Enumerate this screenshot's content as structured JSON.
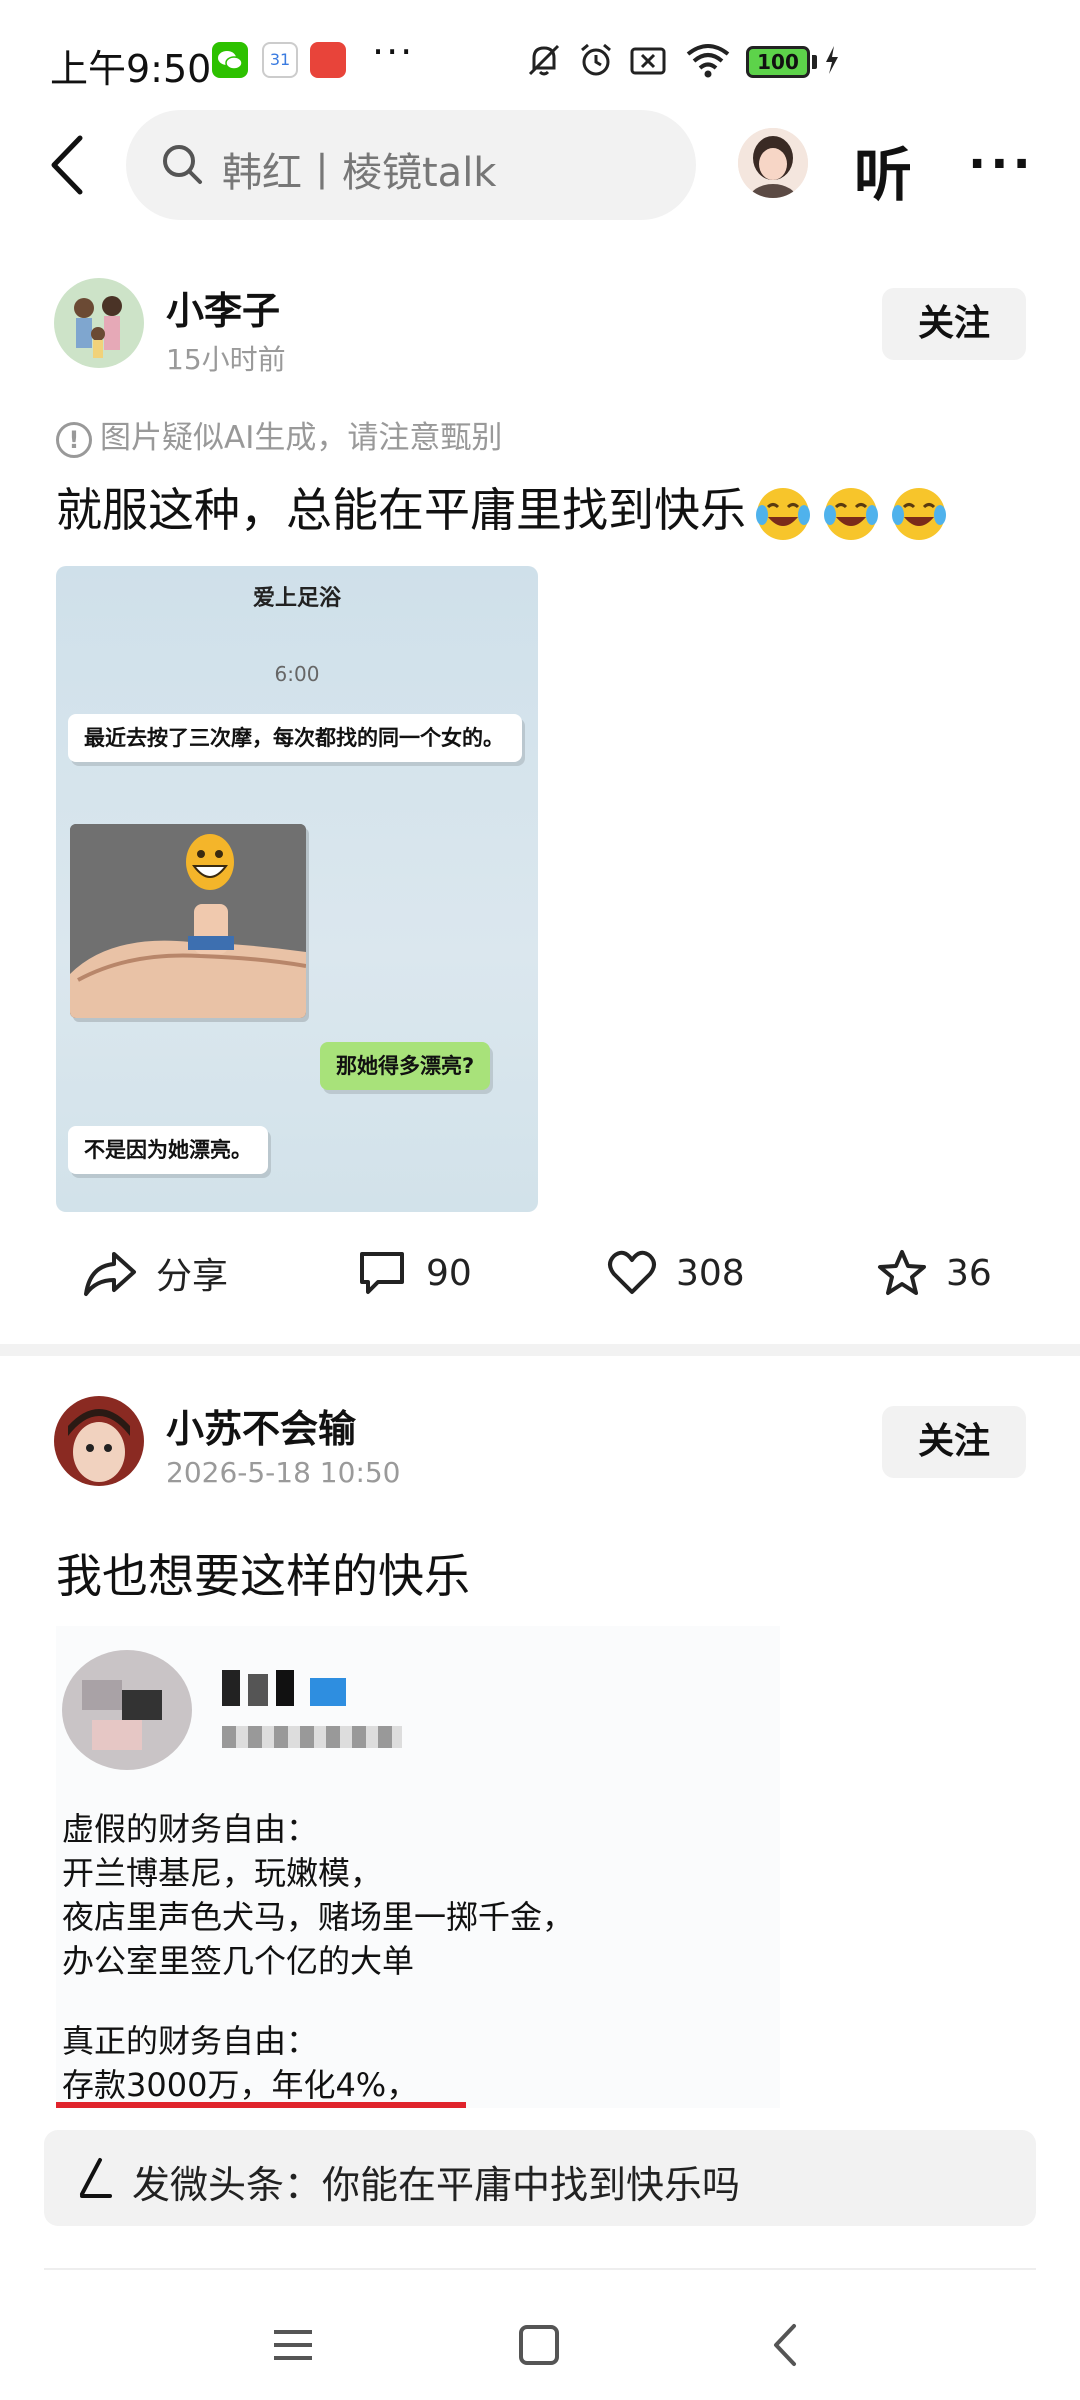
{
  "status_bar": {
    "time": "上午9:50",
    "battery": "100"
  },
  "search": {
    "query": "韩红丨棱镜talk"
  },
  "header": {
    "listen_label": "听"
  },
  "posts": [
    {
      "author": "小李子",
      "time": "15小时前",
      "follow_label": "关注",
      "ai_notice": "图片疑似AI生成，请注意甄别",
      "text": "就服这种，总能在平庸里找到快乐",
      "image": {
        "title": "爱上足浴",
        "time": "6:00",
        "messages": [
          {
            "side": "left",
            "text": "最近去按了三次摩，每次都找的同一个女的。"
          },
          {
            "side": "right",
            "text": "那她得多漂亮?"
          },
          {
            "side": "left",
            "text": "不是因为她漂亮。"
          }
        ]
      },
      "actions": {
        "share": "分享",
        "comments": "90",
        "likes": "308",
        "favorites": "36"
      }
    },
    {
      "author": "小苏不会输",
      "time": "2026-5-18 10:50",
      "follow_label": "关注",
      "text": "我也想要这样的快乐",
      "image": {
        "lines": [
          "虚假的财务自由：",
          "开兰博基尼，玩嫩模，",
          "夜店里声色犬马，赌场里一掷千金，",
          "办公室里签几个亿的大单",
          "",
          "真正的财务自由：",
          "存款3000万，年化4%，"
        ]
      }
    }
  ],
  "compose": {
    "text": "发微头条：你能在平庸中找到快乐吗"
  }
}
